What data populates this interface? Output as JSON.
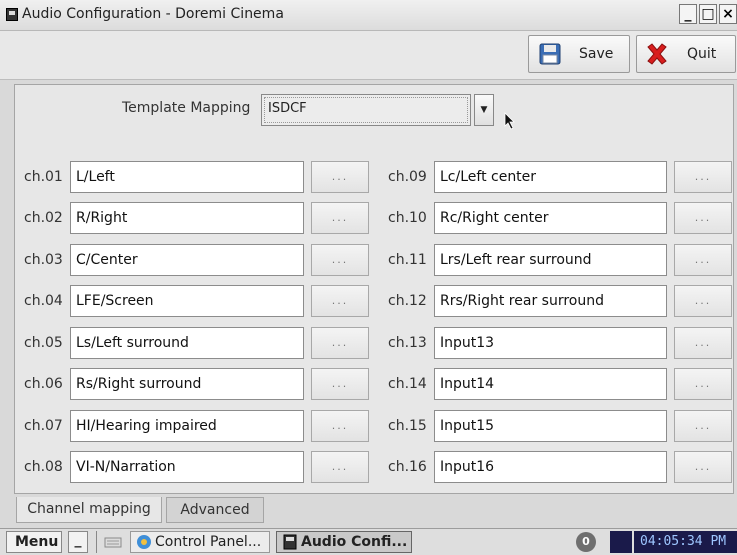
{
  "window": {
    "title": "Audio Configuration - Doremi Cinema",
    "controls": [
      "_",
      "□",
      "×"
    ]
  },
  "toolbar": {
    "save_label": "Save",
    "quit_label": "Quit"
  },
  "template_mapping": {
    "label": "Template Mapping",
    "value": "ISDCF"
  },
  "channels_left": [
    {
      "ch": "ch.01",
      "value": "L/Left"
    },
    {
      "ch": "ch.02",
      "value": "R/Right"
    },
    {
      "ch": "ch.03",
      "value": "C/Center"
    },
    {
      "ch": "ch.04",
      "value": "LFE/Screen"
    },
    {
      "ch": "ch.05",
      "value": "Ls/Left surround"
    },
    {
      "ch": "ch.06",
      "value": "Rs/Right surround"
    },
    {
      "ch": "ch.07",
      "value": "HI/Hearing impaired"
    },
    {
      "ch": "ch.08",
      "value": "VI-N/Narration"
    }
  ],
  "channels_right": [
    {
      "ch": "ch.09",
      "value": "Lc/Left center"
    },
    {
      "ch": "ch.10",
      "value": "Rc/Right center"
    },
    {
      "ch": "ch.11",
      "value": "Lrs/Left rear surround"
    },
    {
      "ch": "ch.12",
      "value": "Rrs/Right rear surround"
    },
    {
      "ch": "ch.13",
      "value": "Input13"
    },
    {
      "ch": "ch.14",
      "value": "Input14"
    },
    {
      "ch": "ch.15",
      "value": "Input15"
    },
    {
      "ch": "ch.16",
      "value": "Input16"
    }
  ],
  "browse_label": "...",
  "tabs": [
    {
      "label": "Channel mapping",
      "active": true
    },
    {
      "label": "Advanced",
      "active": false
    }
  ],
  "taskbar": {
    "menu_label": "Menu",
    "minimize_label": "_",
    "control_panel_label": "Control Panel...",
    "audio_config_label": "Audio Confi...",
    "notification_count": "0",
    "clock": "04:05:34 PM"
  },
  "colors": {
    "quit_icon": "#d81e1e",
    "save_icon": "#3a6db5",
    "clock_bg": "#1a1a4a"
  }
}
